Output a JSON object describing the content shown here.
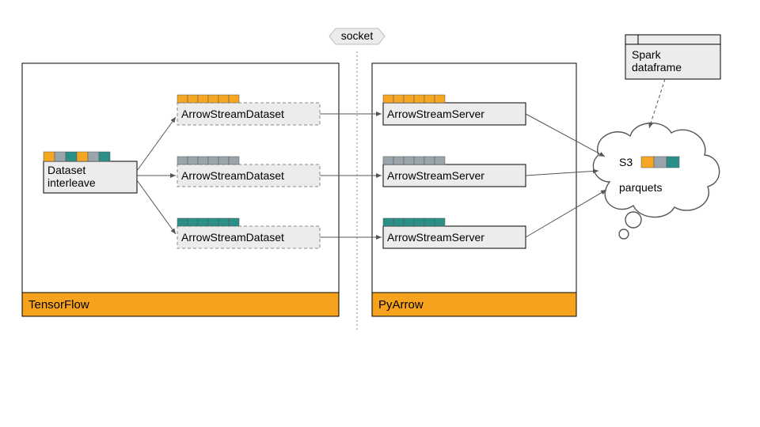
{
  "socket_label": "socket",
  "tensorflow": {
    "title": "TensorFlow",
    "dataset_interleave": "Dataset\ninterleave",
    "streams": [
      {
        "label": "ArrowStreamDataset"
      },
      {
        "label": "ArrowStreamDataset"
      },
      {
        "label": "ArrowStreamDataset"
      }
    ]
  },
  "pyarrow": {
    "title": "PyArrow",
    "servers": [
      {
        "label": "ArrowStreamServer"
      },
      {
        "label": "ArrowStreamServer"
      },
      {
        "label": "ArrowStreamServer"
      }
    ]
  },
  "spark_box": "Spark\ndataframe",
  "cloud": {
    "line1_prefix": "S3",
    "line2": "parquets"
  },
  "colors": {
    "orange": "#f5a623",
    "orange_container": "#f6a21c",
    "teal": "#2a8f87",
    "darkteal": "#1f7a77",
    "grey": "#9aa4ab",
    "lightgrey": "#ececec",
    "box_fill": "#ececec",
    "border": "#000"
  }
}
